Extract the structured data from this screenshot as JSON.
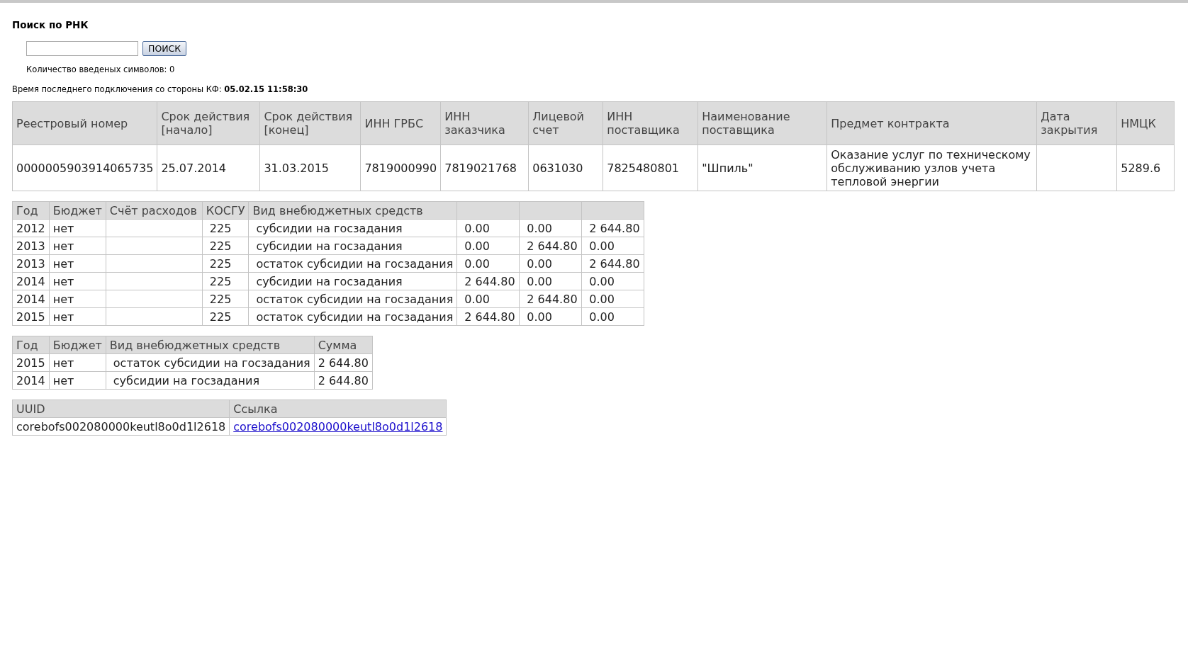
{
  "search": {
    "title": "Поиск по РНК",
    "button": "ПОИСК",
    "char_count": "Количество введеных символов: 0"
  },
  "last_connection": {
    "label": "Время последнего подключения со стороны КФ:",
    "value": "05.02.15 11:58:30"
  },
  "contract_table": {
    "columns": [
      {
        "label": "Реестровый номер"
      },
      {
        "label": "Срок действия [начало]"
      },
      {
        "label": "Срок действия [конец]"
      },
      {
        "label": "ИНН ГРБС"
      },
      {
        "label": "ИНН заказчика"
      },
      {
        "label": "Лицевой счет"
      },
      {
        "label": "ИНН поставщика"
      },
      {
        "label": "Наименование поставщика"
      },
      {
        "label": "Предмет контракта"
      },
      {
        "label": "Дата закрытия"
      },
      {
        "label": "НМЦК"
      }
    ],
    "rows": [
      [
        "0000005903914065735",
        "25.07.2014",
        "31.03.2015",
        "7819000990",
        "7819021768",
        "0631030",
        "7825480801",
        "\"Шпиль\"",
        "Оказание услуг по техническому обслуживанию узлов учета тепловой энергии",
        null,
        "5289.6"
      ]
    ]
  },
  "funding_table": {
    "columns": [
      {
        "label": "Год"
      },
      {
        "label": "Бюджет"
      },
      {
        "label": "Счёт расходов"
      },
      {
        "label": "КОСГУ"
      },
      {
        "label": "Вид внебюджетных средств"
      }
    ],
    "rows": [
      [
        "2012",
        "нет",
        null,
        "225",
        "субсидии на госзадания",
        "0.00",
        "0.00",
        "2 644.80"
      ],
      [
        "2013",
        "нет",
        null,
        "225",
        "субсидии на госзадания",
        "0.00",
        "2 644.80",
        "0.00"
      ],
      [
        "2013",
        "нет",
        null,
        "225",
        "остаток субсидии на госзадания",
        "0.00",
        "0.00",
        "2 644.80"
      ],
      [
        "2014",
        "нет",
        null,
        "225",
        "субсидии на госзадания",
        "2 644.80",
        "0.00",
        "0.00"
      ],
      [
        "2014",
        "нет",
        null,
        "225",
        "остаток субсидии на госзадания",
        "0.00",
        "2 644.80",
        "0.00"
      ],
      [
        "2015",
        "нет",
        null,
        "225",
        "остаток субсидии на госзадания",
        "2 644.80",
        "0.00",
        "0.00"
      ]
    ]
  },
  "sum_table": {
    "columns": [
      {
        "label": "Год"
      },
      {
        "label": "Бюджет"
      },
      {
        "label": "Вид внебюджетных средств"
      },
      {
        "label": "Сумма"
      }
    ],
    "rows": [
      [
        "2015",
        "нет",
        "остаток субсидии на госзадания",
        "2 644.80"
      ],
      [
        "2014",
        "нет",
        "субсидии на госзадания",
        "2 644.80"
      ]
    ]
  },
  "uuid_table": {
    "columns": [
      {
        "label": "UUID",
        "kind": "text"
      },
      {
        "label": "Ссылка",
        "kind": "link"
      }
    ],
    "rows": [
      [
        "corebofs002080000keutl8o0d1l2618",
        "corebofs002080000keutl8o0d1l2618"
      ]
    ]
  }
}
